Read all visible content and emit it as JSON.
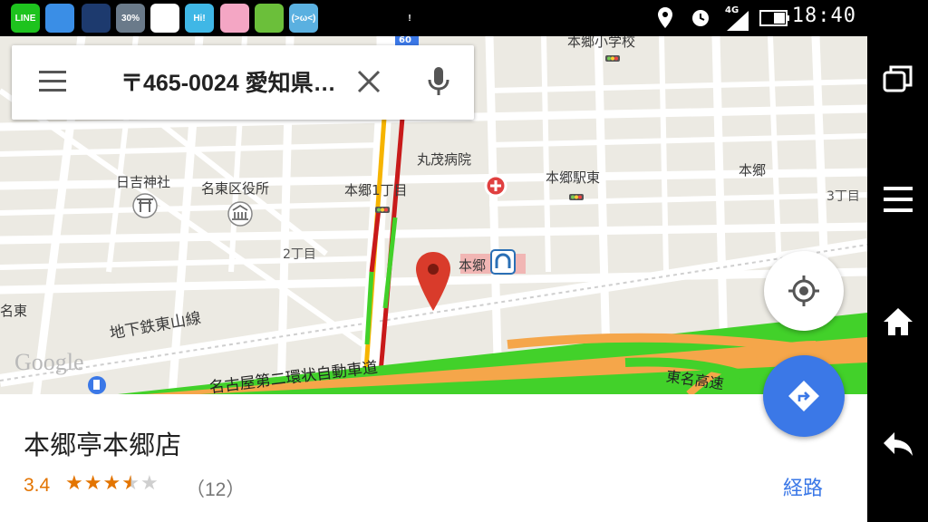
{
  "status_bar": {
    "time": "18:40",
    "network": "4G",
    "weather_percent": "30%",
    "app_icons": [
      {
        "name": "line-app-icon",
        "text": "LINE",
        "color": "#1ec31e"
      },
      {
        "name": "news-app-icon",
        "text": "",
        "color": "#3a8ee6"
      },
      {
        "name": "weather-night-icon",
        "text": "",
        "color": "#1d3a6e"
      },
      {
        "name": "weather-cloud-icon",
        "text": "30%",
        "color": "#6a7a8a"
      },
      {
        "name": "firefox-like-icon",
        "text": "",
        "color": "#ffffff"
      },
      {
        "name": "hi-app-icon",
        "text": "Hi!",
        "color": "#3fb7e6"
      },
      {
        "name": "pink-app-icon",
        "text": "",
        "color": "#f4a6c4"
      },
      {
        "name": "help-app-icon",
        "text": "",
        "color": "#6bbf3a"
      },
      {
        "name": "emoticon-app-icon",
        "text": "(>ω<)",
        "color": "#5ab0e0"
      },
      {
        "name": "rotate-icon",
        "text": "",
        "color": "#000000"
      },
      {
        "name": "leaf-icon",
        "text": "",
        "color": "#000000"
      },
      {
        "name": "alert-icon",
        "text": "!",
        "color": "#000000"
      }
    ]
  },
  "search": {
    "text": "〒465-0024 愛知県…"
  },
  "map": {
    "labels": [
      {
        "name": "label-hongo-elementary",
        "text": "本郷小学校"
      },
      {
        "name": "label-marushige-hospital",
        "text": "丸茂病院"
      },
      {
        "name": "label-hongo-station-east",
        "text": "本郷駅東"
      },
      {
        "name": "label-hongo",
        "text": "本郷"
      },
      {
        "name": "label-hongo-1chome",
        "text": "本郷1丁目"
      },
      {
        "name": "label-hiyoshi-shrine",
        "text": "日吉神社"
      },
      {
        "name": "label-meito-ward-office",
        "text": "名東区役所"
      },
      {
        "name": "label-2chome",
        "text": "2丁目"
      },
      {
        "name": "label-3chome",
        "text": "3丁目"
      },
      {
        "name": "label-hongo-station",
        "text": "本郷"
      },
      {
        "name": "label-higashiyama-line",
        "text": "地下鉄東山線"
      },
      {
        "name": "label-nagoya-loop",
        "text": "名古屋第二環状自動車道"
      },
      {
        "name": "label-tomei",
        "text": "東名高速"
      },
      {
        "name": "label-meito-left",
        "text": "名東"
      },
      {
        "name": "label-route-shield",
        "text": "60"
      },
      {
        "name": "google-watermark",
        "text": "Google"
      }
    ],
    "colors": {
      "road": "#ffffff",
      "traffic_green": "#42d12a",
      "traffic_red": "#c81a1a",
      "traffic_yellow": "#f6b400",
      "highway": "#f5a64a",
      "pin": "#d93b2b"
    }
  },
  "place": {
    "name": "本郷亭本郷店",
    "rating": "3.4",
    "stars": 3.4,
    "reviews": "（12）",
    "route_label": "経路"
  },
  "accent_color": "#3b78e7"
}
